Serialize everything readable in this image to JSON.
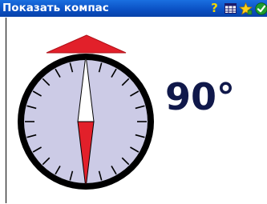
{
  "window": {
    "title": "Показать компас"
  },
  "toolbar": {
    "icons": [
      "help-icon",
      "grid-icon",
      "favorites-star-icon",
      "ok-check-icon"
    ]
  },
  "compass": {
    "heading_text": "90°",
    "heading_degrees": 90,
    "tick_count": 24,
    "colors": {
      "face": "#cccbe6",
      "rim": "#000000",
      "north_needle": "#e2202a",
      "south_needle": "#ffffff",
      "pointer": "#e2202a",
      "heading_text": "#10184a",
      "title_bar": "#0a4fc2"
    }
  }
}
